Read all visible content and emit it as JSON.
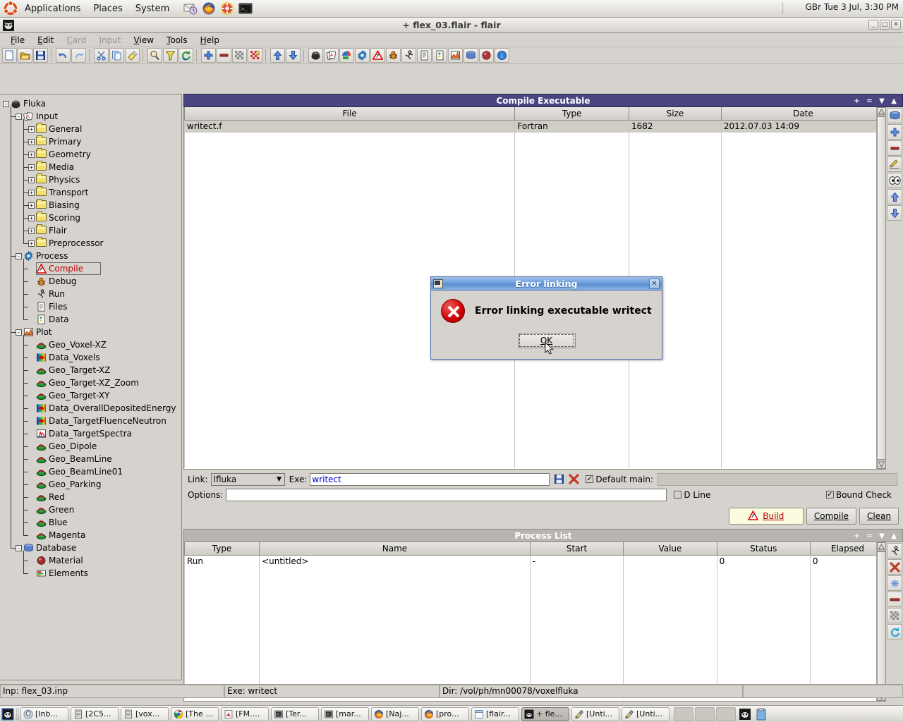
{
  "desktop": {
    "menus": [
      "Applications",
      "Places",
      "System"
    ],
    "panel_icons": [
      "evolution-mail-icon",
      "firefox-icon",
      "help-lifebuoy-icon",
      "terminal-icon"
    ],
    "clock": "GBr Tue  3 Jul,  3:30 PM",
    "logo_icon": "ubuntu-logo-icon"
  },
  "window": {
    "title": "+ flex_03.flair - flair",
    "icon": "flair-icon",
    "buttons": {
      "minimize": "_",
      "maximize": "□",
      "close": "✕"
    }
  },
  "menubar": [
    {
      "label": "File",
      "mnemonic": "F",
      "disabled": false
    },
    {
      "label": "Edit",
      "mnemonic": "E",
      "disabled": false
    },
    {
      "label": "Card",
      "mnemonic": "C",
      "disabled": true
    },
    {
      "label": "Input",
      "mnemonic": "I",
      "disabled": true
    },
    {
      "label": "View",
      "mnemonic": "V",
      "disabled": false
    },
    {
      "label": "Tools",
      "mnemonic": "T",
      "disabled": false
    },
    {
      "label": "Help",
      "mnemonic": "H",
      "disabled": false
    }
  ],
  "toolbar": {
    "icons": [
      "new-file-icon",
      "open-folder-icon",
      "save-icon",
      "sep",
      "undo-icon",
      "redo-icon",
      "sep",
      "cut-scissors-icon",
      "copy-icon",
      "paste-brush-icon",
      "sep",
      "search-magnifier-icon",
      "filter-funnel-icon",
      "refresh-icon",
      "sep",
      "add-plus-icon",
      "remove-minus-icon",
      "checker-gray-icon",
      "checker-red-icon",
      "sep",
      "move-up-icon",
      "move-down-icon",
      "sep",
      "fluka-pot-icon",
      "input-cards-icon",
      "geometry-icon",
      "process-gear-icon",
      "compile-warning-icon",
      "debug-bug-icon",
      "run-person-icon",
      "files-doc-icon",
      "data-icon",
      "plot-chart-icon",
      "database-icon",
      "material-sphere-icon",
      "info-icon"
    ]
  },
  "tree": {
    "items": [
      {
        "label": "Fluka",
        "depth": 0,
        "expander": "-",
        "icon": "fluka-pot-icon",
        "selected": false
      },
      {
        "label": "Input",
        "depth": 1,
        "expander": "-",
        "icon": "input-cards-icon",
        "selected": false
      },
      {
        "label": "General",
        "depth": 2,
        "expander": "+",
        "icon": "folder-icon",
        "selected": false
      },
      {
        "label": "Primary",
        "depth": 2,
        "expander": "+",
        "icon": "folder-icon",
        "selected": false
      },
      {
        "label": "Geometry",
        "depth": 2,
        "expander": "+",
        "icon": "folder-icon",
        "selected": false
      },
      {
        "label": "Media",
        "depth": 2,
        "expander": "+",
        "icon": "folder-icon",
        "selected": false
      },
      {
        "label": "Physics",
        "depth": 2,
        "expander": "+",
        "icon": "folder-icon",
        "selected": false
      },
      {
        "label": "Transport",
        "depth": 2,
        "expander": "+",
        "icon": "folder-icon",
        "selected": false
      },
      {
        "label": "Biasing",
        "depth": 2,
        "expander": "+",
        "icon": "folder-icon",
        "selected": false
      },
      {
        "label": "Scoring",
        "depth": 2,
        "expander": "+",
        "icon": "folder-icon",
        "selected": false
      },
      {
        "label": "Flair",
        "depth": 2,
        "expander": "+",
        "icon": "folder-icon",
        "selected": false
      },
      {
        "label": "Preprocessor",
        "depth": 2,
        "expander": "+",
        "icon": "folder-icon",
        "selected": false
      },
      {
        "label": "Process",
        "depth": 1,
        "expander": "-",
        "icon": "process-gear-icon",
        "selected": false
      },
      {
        "label": "Compile",
        "depth": 2,
        "expander": "",
        "icon": "compile-warning-icon",
        "selected": true
      },
      {
        "label": "Debug",
        "depth": 2,
        "expander": "",
        "icon": "debug-bug-icon",
        "selected": false
      },
      {
        "label": "Run",
        "depth": 2,
        "expander": "",
        "icon": "run-person-icon",
        "selected": false
      },
      {
        "label": "Files",
        "depth": 2,
        "expander": "",
        "icon": "files-doc-icon",
        "selected": false
      },
      {
        "label": "Data",
        "depth": 2,
        "expander": "",
        "icon": "data-icon",
        "selected": false
      },
      {
        "label": "Plot",
        "depth": 1,
        "expander": "-",
        "icon": "plot-chart-icon",
        "selected": false
      },
      {
        "label": "Geo_Voxel-XZ",
        "depth": 2,
        "expander": "",
        "icon": "geo-plot-icon",
        "selected": false
      },
      {
        "label": "Data_Voxels",
        "depth": 2,
        "expander": "",
        "icon": "data-plot-icon",
        "selected": false
      },
      {
        "label": "Geo_Target-XZ",
        "depth": 2,
        "expander": "",
        "icon": "geo-plot-icon",
        "selected": false
      },
      {
        "label": "Geo_Target-XZ_Zoom",
        "depth": 2,
        "expander": "",
        "icon": "geo-plot-icon",
        "selected": false
      },
      {
        "label": "Geo_Target-XY",
        "depth": 2,
        "expander": "",
        "icon": "geo-plot-icon",
        "selected": false
      },
      {
        "label": "Data_OverallDepositedEnergy",
        "depth": 2,
        "expander": "",
        "icon": "data-plot-icon",
        "selected": false
      },
      {
        "label": "Data_TargetFluenceNeutron",
        "depth": 2,
        "expander": "",
        "icon": "data-plot-icon",
        "selected": false
      },
      {
        "label": "Data_TargetSpectra",
        "depth": 2,
        "expander": "",
        "icon": "spectra-plot-icon",
        "selected": false
      },
      {
        "label": "Geo_Dipole",
        "depth": 2,
        "expander": "",
        "icon": "geo-plot-icon",
        "selected": false
      },
      {
        "label": "Geo_BeamLine",
        "depth": 2,
        "expander": "",
        "icon": "geo-plot-icon",
        "selected": false
      },
      {
        "label": "Geo_BeamLine01",
        "depth": 2,
        "expander": "",
        "icon": "geo-plot-icon",
        "selected": false
      },
      {
        "label": "Geo_Parking",
        "depth": 2,
        "expander": "",
        "icon": "geo-plot-icon",
        "selected": false
      },
      {
        "label": "Red",
        "depth": 2,
        "expander": "",
        "icon": "geo-plot-icon",
        "selected": false
      },
      {
        "label": "Green",
        "depth": 2,
        "expander": "",
        "icon": "geo-plot-icon",
        "selected": false
      },
      {
        "label": "Blue",
        "depth": 2,
        "expander": "",
        "icon": "geo-plot-icon",
        "selected": false
      },
      {
        "label": "Magenta",
        "depth": 2,
        "expander": "",
        "icon": "geo-plot-icon",
        "selected": false
      },
      {
        "label": "Database",
        "depth": 1,
        "expander": "-",
        "icon": "database-icon",
        "selected": false
      },
      {
        "label": "Material",
        "depth": 2,
        "expander": "",
        "icon": "material-sphere-icon",
        "selected": false
      },
      {
        "label": "Elements",
        "depth": 2,
        "expander": "",
        "icon": "elements-icon",
        "selected": false
      }
    ]
  },
  "compile_panel": {
    "title": "Compile Executable",
    "header_controls": [
      "+",
      "=",
      "▼",
      "▲"
    ],
    "columns": [
      "File",
      "Type",
      "Size",
      "Date"
    ],
    "rows": [
      {
        "file": "writect.f",
        "type": "Fortran",
        "size": "1682",
        "date": "2012.07.03 14:09"
      }
    ],
    "side_tools": [
      "database-icon",
      "add-plus-icon",
      "remove-minus-icon",
      "edit-pencil-icon",
      "view-eyes-icon",
      "move-up-icon",
      "move-down-icon"
    ]
  },
  "form": {
    "link_label": "Link:",
    "link_value": "lfluka",
    "exe_label": "Exe:",
    "exe_value": "writect",
    "save_icon": "save-icon",
    "delete_icon": "delete-red-x-icon",
    "default_main_label": "Default main:",
    "default_main_checked": true,
    "default_main_value": "",
    "options_label": "Options:",
    "options_value": "",
    "options_placeholder": "",
    "dline_label": "D Line",
    "dline_checked": false,
    "bound_check_label": "Bound Check",
    "bound_check_checked": true,
    "buttons": {
      "build": "Build",
      "build_mnemonic": "u",
      "build_icon": "compile-warning-icon",
      "compile": "Compile",
      "clean": "Clean"
    }
  },
  "process_panel": {
    "title": "Process List",
    "header_controls": [
      "+",
      "=",
      "▼",
      "▲"
    ],
    "columns": [
      "Type",
      "Name",
      "Start",
      "Value",
      "Status",
      "Elapsed"
    ],
    "rows": [
      {
        "type": "Run",
        "name": "<untitled>",
        "start": "-",
        "value": "",
        "status": "0",
        "elapsed": "0"
      }
    ],
    "side_tools": [
      "run-person-icon",
      "stop-red-x-icon",
      "refresh-blue-icon",
      "remove-minus-icon",
      "checker-gray-icon",
      "sync-cyan-icon"
    ]
  },
  "statusbar": {
    "input": "Inp: flex_03.inp",
    "exe": "Exe: writect",
    "dir": "Dir: /vol/ph/mn00078/voxelfluka"
  },
  "dialog": {
    "title": "Error linking",
    "message": "Error linking executable writect",
    "ok_label": "OK",
    "ok_mnemonic": "K",
    "close_label": "✕",
    "icon": "error-circle-x-icon"
  },
  "taskbar": {
    "items": [
      {
        "label": "[Inb...",
        "icon": "evolution-icon",
        "active": false
      },
      {
        "label": "[2C5...",
        "icon": "document-icon",
        "active": false
      },
      {
        "label": "[vox...",
        "icon": "document-icon",
        "active": false
      },
      {
        "label": "[The ...",
        "icon": "chrome-icon",
        "active": false
      },
      {
        "label": "[FM....",
        "icon": "pdf-icon",
        "active": false
      },
      {
        "label": "[Ter...",
        "icon": "terminal-icon",
        "active": false
      },
      {
        "label": "[mar...",
        "icon": "terminal-icon",
        "active": false
      },
      {
        "label": "[Naj...",
        "icon": "firefox-icon",
        "active": false
      },
      {
        "label": "[pro...",
        "icon": "firefox-icon",
        "active": false
      },
      {
        "label": "[flair...",
        "icon": "window-icon",
        "active": false
      },
      {
        "label": "+ fle...",
        "icon": "flair-icon",
        "active": true
      },
      {
        "label": "[Unti...",
        "icon": "gimp-icon",
        "active": false
      },
      {
        "label": "[Unti...",
        "icon": "gimp-icon",
        "active": false
      }
    ],
    "tray_icons": [
      "flair-tray-icon",
      "clipboard-icon"
    ]
  },
  "colors": {
    "panel_header_active": "#4a4480",
    "panel_header_inactive": "#b8b5b0",
    "selection_red": "#c00000",
    "entry_text_blue": "#0000cc",
    "desktop_gray": "#d6d3ce",
    "dialog_title_blue": "#5a8ed0"
  }
}
